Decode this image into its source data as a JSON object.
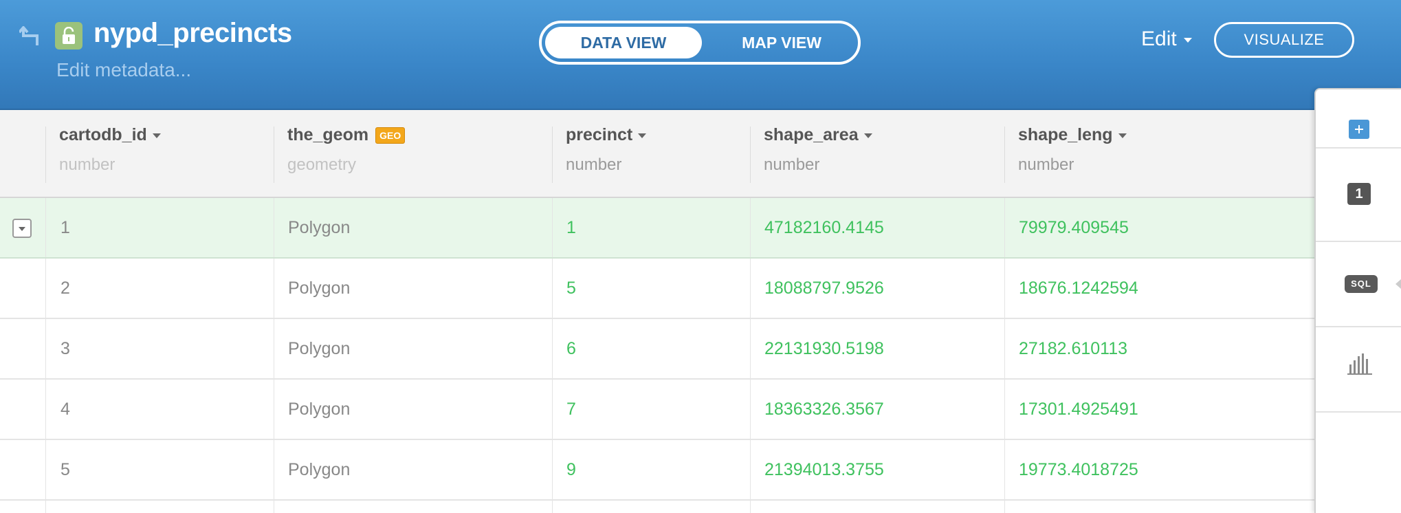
{
  "header": {
    "title": "nypd_precincts",
    "edit_metadata": "Edit metadata...",
    "tabs": [
      {
        "label": "DATA VIEW",
        "active": true
      },
      {
        "label": "MAP VIEW",
        "active": false
      }
    ],
    "edit_label": "Edit",
    "visualize_label": "VISUALIZE",
    "colors": {
      "header_blue": "#3a86c8",
      "lock_green": "#9bc27c"
    }
  },
  "table": {
    "columns": [
      {
        "name": "cartodb_id",
        "type": "number"
      },
      {
        "name": "the_geom",
        "type": "geometry",
        "badge": "GEO"
      },
      {
        "name": "precinct",
        "type": "number"
      },
      {
        "name": "shape_area",
        "type": "number"
      },
      {
        "name": "shape_leng",
        "type": "number"
      }
    ],
    "rows": [
      [
        "1",
        "Polygon",
        "1",
        "47182160.4145",
        "79979.409545"
      ],
      [
        "2",
        "Polygon",
        "5",
        "18088797.9526",
        "18676.1242594"
      ],
      [
        "3",
        "Polygon",
        "6",
        "22131930.5198",
        "27182.610113"
      ],
      [
        "4",
        "Polygon",
        "7",
        "18363326.3567",
        "17301.4925491"
      ],
      [
        "5",
        "Polygon",
        "9",
        "21394013.3755",
        "19773.4018725"
      ]
    ],
    "colors": {
      "numeric": "#3fc15e",
      "selected_row": "#e8f7ea",
      "geo_badge": "#f3a71b"
    }
  },
  "right_panel": {
    "filter_count": "1",
    "sql_label": "SQL",
    "icons": [
      "add-icon",
      "filter-count-badge",
      "sql-icon",
      "bar-chart-icon"
    ]
  }
}
